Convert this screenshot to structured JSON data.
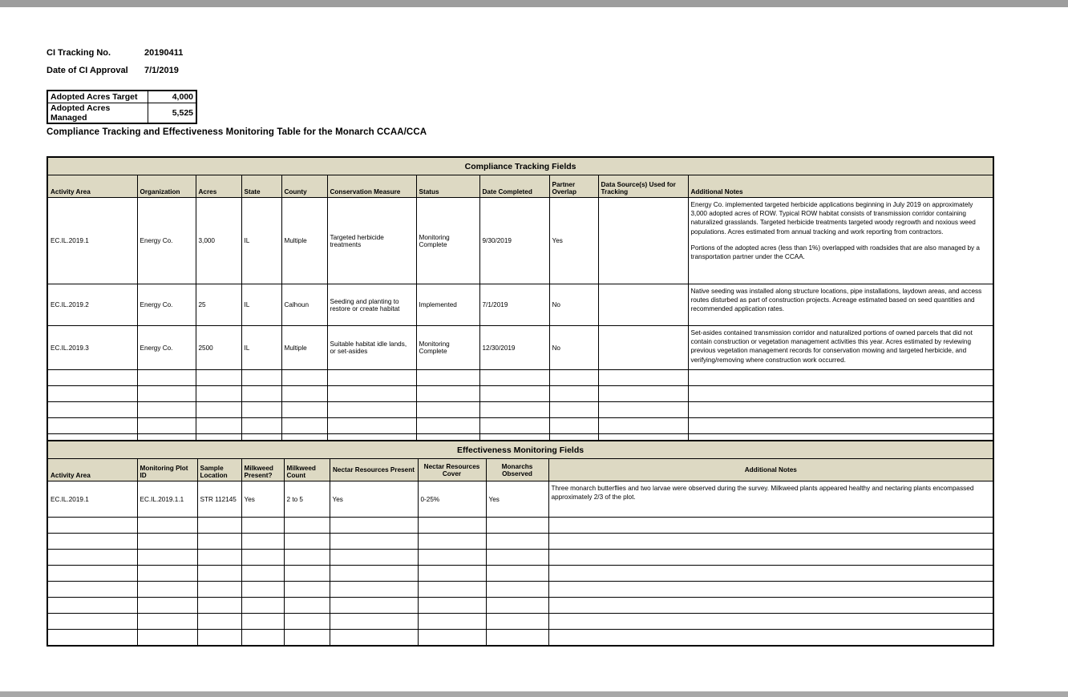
{
  "meta": {
    "tracking_label": "CI Tracking No.",
    "tracking_value": "20190411",
    "approval_label": "Date of CI Approval",
    "approval_value": "7/1/2019"
  },
  "acres_table": {
    "rows": [
      {
        "label": "Adopted Acres Target",
        "value": "4,000"
      },
      {
        "label": "Adopted Acres Managed",
        "value": "5,525"
      }
    ]
  },
  "main_title": "Compliance Tracking and Effectiveness Monitoring Table for the Monarch CCAA/CCA",
  "compliance": {
    "band_title": "Compliance Tracking Fields",
    "columns": [
      "Activity Area",
      "Organization",
      "Acres",
      "State",
      "County",
      "Conservation Measure",
      "Status",
      "Date Completed",
      "Partner Overlap",
      "Data Source(s) Used for Tracking",
      "Additional Notes"
    ],
    "rows": [
      {
        "activity_area": "EC.IL.2019.1",
        "organization": "Energy Co.",
        "acres": "3,000",
        "state": "IL",
        "county": "Multiple",
        "conservation_measure": "Targeted herbicide treatments",
        "status": "Monitoring Complete",
        "date_completed": "9/30/2019",
        "partner_overlap": "Yes",
        "data_source": "",
        "notes_p1": "Energy Co. implemented targeted herbicide applications beginning in July 2019 on approximately 3,000 adopted acres of ROW. Typical ROW habitat consists of transmission corridor containing naturalized grasslands. Targeted herbicide treatments targeted woody regrowth and noxious weed populations. Acres estimated from annual tracking and work reporting from contractors.",
        "notes_p2": "Portions of the adopted acres (less than 1%) overlapped with roadsides that are also managed by a transportation partner under the CCAA."
      },
      {
        "activity_area": "EC.IL.2019.2",
        "organization": "Energy Co.",
        "acres": "25",
        "state": "IL",
        "county": "Calhoun",
        "conservation_measure": "Seeding and planting to restore or create habitat",
        "status": "Implemented",
        "date_completed": "7/1/2019",
        "partner_overlap": "No",
        "data_source": "",
        "notes_p1": "Native seeding was installed along structure locations, pipe installations, laydown areas, and access routes disturbed as part of construction projects. Acreage estimated based on seed quantities and recommended application rates.",
        "notes_p2": ""
      },
      {
        "activity_area": "EC.IL.2019.3",
        "organization": "Energy Co.",
        "acres": "2500",
        "state": "IL",
        "county": "Multiple",
        "conservation_measure": "Suitable habitat idle lands, or set-asides",
        "status": "Monitoring Complete",
        "date_completed": "12/30/2019",
        "partner_overlap": "No",
        "data_source": "",
        "notes_p1": "Set-asides contained transmission corridor and naturalized portions of owned parcels that did not contain construction or vegetation management activities this year. Acres estimated by reviewing previous vegetation management records for conservation mowing and targeted herbicide, and verifying/removing where construction work occurred.",
        "notes_p2": ""
      }
    ],
    "empty_row_count": 5
  },
  "effectiveness": {
    "band_title": "Effectiveness Monitoring Fields",
    "columns": [
      "Activity Area",
      "Monitoring Plot ID",
      "Sample Location",
      "Milkweed Present?",
      "Milkweed Count",
      "Nectar Resources Present",
      "Nectar Resources Cover",
      "Monarchs Observed",
      "Additional Notes"
    ],
    "rows": [
      {
        "activity_area": "EC.IL.2019.1",
        "plot_id": "EC.IL.2019.1.1",
        "sample_location": "STR 112145",
        "milkweed_present": "Yes",
        "milkweed_count": "2 to 5",
        "nectar_present": "Yes",
        "nectar_cover": "0-25%",
        "monarchs_observed": "Yes",
        "notes": "Three monarch butterflies and two larvae were observed during the survey. Milkweed plants appeared healthy and nectaring plants encompassed approximately 2/3 of the plot."
      }
    ],
    "empty_row_count": 8
  },
  "colors": {
    "header_fill": "#ddd9c3",
    "grid_line": "#000000",
    "page_background": "#ffffff",
    "chrome_bar": "#9d9d9d"
  }
}
